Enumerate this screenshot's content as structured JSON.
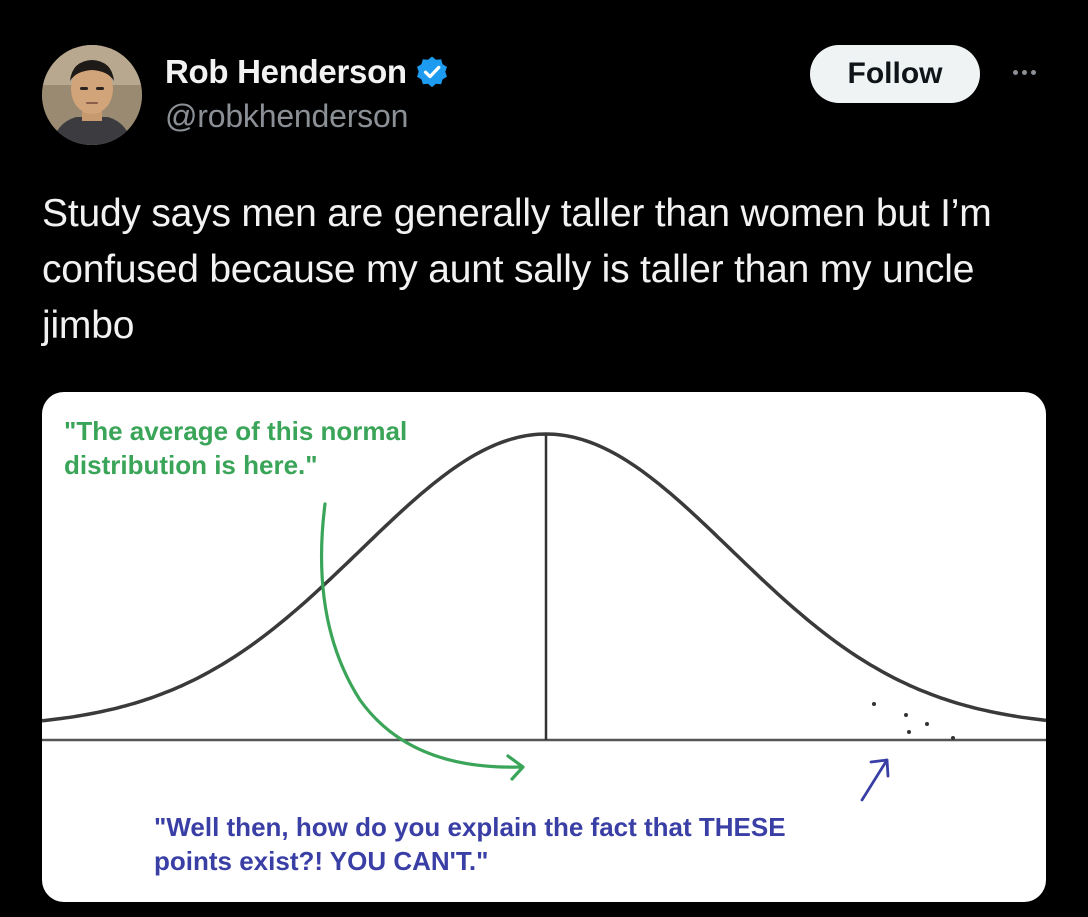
{
  "author": {
    "display_name": "Rob Henderson",
    "handle": "@robkhenderson",
    "verified_icon": "verified-badge-icon"
  },
  "actions": {
    "follow_label": "Follow",
    "more_icon": "more-options-icon"
  },
  "tweet": {
    "text": "Study says men are generally taller than women but I’m confused because my aunt sally is taller than my uncle jimbo"
  },
  "media": {
    "green_annotation": "\"The average of this normal\ndistribution is here.\"",
    "blue_annotation": "\"Well then, how do you explain the fact that THESE\npoints exist?!  YOU CAN'T.\""
  },
  "colors": {
    "background": "#000000",
    "verified_blue": "#1d9bf0",
    "annotation_green": "#3aa558",
    "annotation_blue": "#3a3fa6",
    "curve": "#333333"
  }
}
